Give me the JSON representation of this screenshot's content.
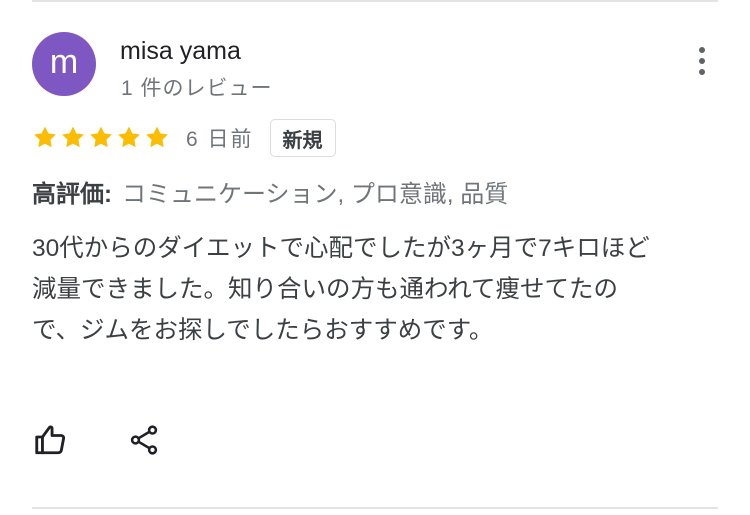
{
  "review": {
    "author": {
      "initial": "m",
      "name": "misa yama",
      "review_count": "1 件のレビュー",
      "avatar_color": "#7e57c2"
    },
    "rating": {
      "stars": 5,
      "max_stars": 5,
      "star_color": "#fbbc04"
    },
    "date": "6 日前",
    "badge": "新規",
    "highlights": {
      "label": "高評価:",
      "value": "コミュニケーション, プロ意識, 品質"
    },
    "text": "30代からのダイエットで心配でしたが3ヶ月で7キロほど減量できました。知り合いの方も通われて痩せてたので、ジムをお探しでしたらおすすめです。",
    "actions": {
      "like_icon": "thumb-up-icon",
      "share_icon": "share-icon",
      "more_icon": "more-vertical-icon"
    }
  }
}
